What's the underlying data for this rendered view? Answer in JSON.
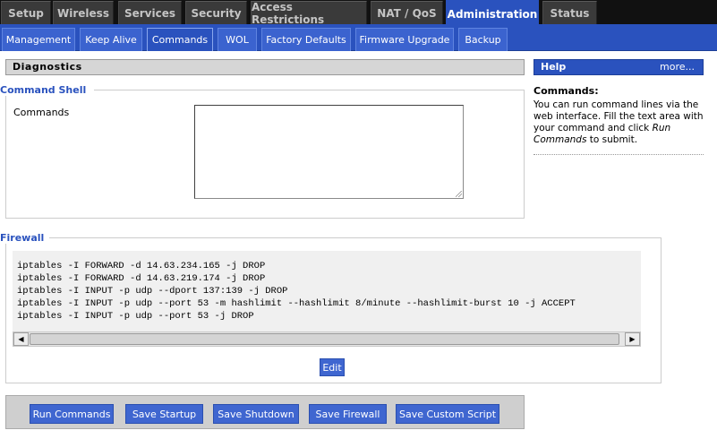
{
  "top_tabs": [
    "Setup",
    "Wireless",
    "Services",
    "Security",
    "Access Restrictions",
    "NAT / QoS",
    "Administration",
    "Status"
  ],
  "sub_tabs": [
    "Management",
    "Keep Alive",
    "Commands",
    "WOL",
    "Factory Defaults",
    "Firmware Upgrade",
    "Backup"
  ],
  "section_title": "Diagnostics",
  "command_shell": {
    "legend": "Command Shell",
    "label": "Commands",
    "value": ""
  },
  "firewall": {
    "legend": "Firewall",
    "lines": [
      "iptables -I FORWARD -d 14.63.234.165 -j DROP",
      "iptables -I FORWARD -d 14.63.219.174 -j DROP",
      "iptables -I INPUT -p udp --dport 137:139 -j DROP",
      "iptables -I INPUT -p udp --port 53 -m hashlimit --hashlimit 8/minute --hashlimit-burst 10 -j ACCEPT",
      "iptables -I INPUT -p udp --port 53 -j DROP"
    ],
    "edit_label": "Edit"
  },
  "buttons": {
    "run_commands": "Run Commands",
    "save_startup": "Save Startup",
    "save_shutdown": "Save Shutdown",
    "save_firewall": "Save Firewall",
    "save_custom_script": "Save Custom Script"
  },
  "help": {
    "title": "Help",
    "more": "more...",
    "heading": "Commands:",
    "text_before": "You can run command lines via the web interface. Fill the text area with your command and click ",
    "text_em": "Run Commands",
    "text_after": " to submit."
  },
  "colors": {
    "accent": "#2a52be",
    "top_bar": "#111111",
    "tab_inactive": "#3a3a3a",
    "button": "#3f66d0"
  }
}
